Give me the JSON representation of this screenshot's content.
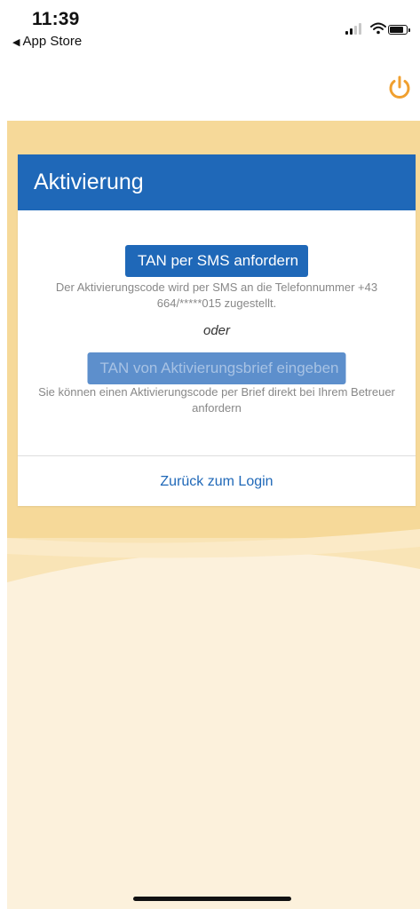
{
  "status_bar": {
    "time": "11:39",
    "back_label": "App Store",
    "back_glyph": "◀",
    "icons": [
      "cellular-signal-icon",
      "wifi-icon",
      "battery-icon"
    ]
  },
  "header": {
    "power_icon": "power-icon",
    "accent_color": "#f0a030"
  },
  "activation": {
    "title": "Aktivierung",
    "sms_button_label": "TAN per SMS anfordern",
    "sms_description": "Der Aktivierungscode wird per SMS an die Telefonnummer +43 664/*****015 zugestellt.",
    "separator": "oder",
    "letter_button_label": "TAN von Aktivierungsbrief eingeben",
    "letter_description": "Sie können einen Aktivierungscode per Brief direkt bei Ihrem Betreuer anfordern",
    "back_to_login": "Zurück zum Login"
  },
  "colors": {
    "primary": "#1f68b8",
    "primary_disabled": "#5d8fcc",
    "background_light": "#fcf1dc",
    "background_wave": "#f6d999",
    "text_muted": "#888888"
  }
}
